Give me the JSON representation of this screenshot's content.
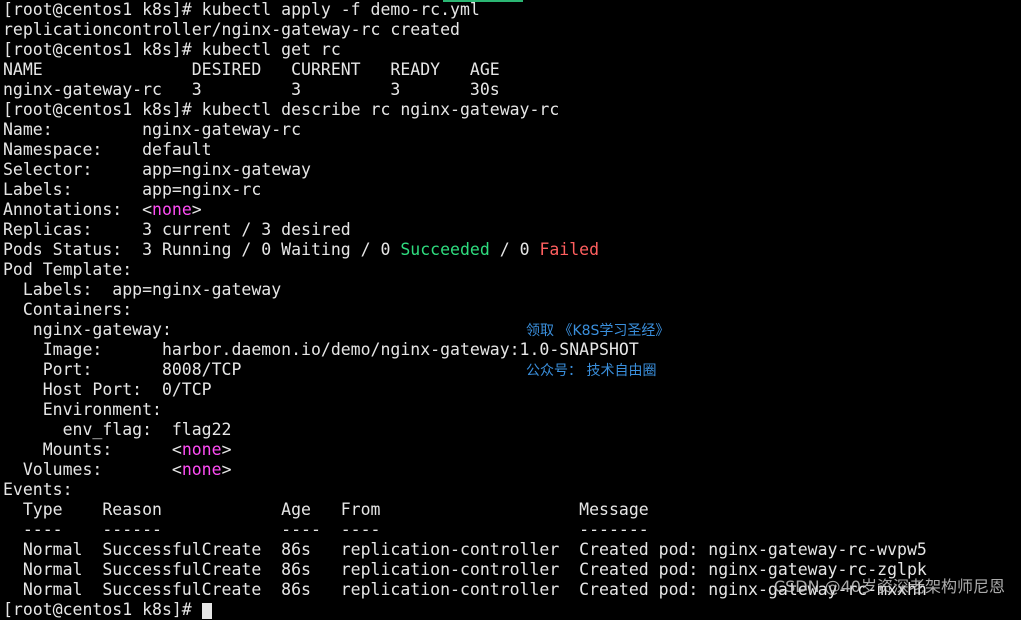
{
  "terminal": {
    "lines": [
      [
        {
          "t": "[root@centos1 k8s]# kubectl apply -f demo-rc.yml"
        }
      ],
      [
        {
          "t": "replicationcontroller/nginx-gateway-rc created"
        }
      ],
      [
        {
          "t": "[root@centos1 k8s]# kubectl get rc"
        }
      ],
      [
        {
          "t": "NAME               DESIRED   CURRENT   READY   AGE"
        }
      ],
      [
        {
          "t": "nginx-gateway-rc   3         3         3       30s"
        }
      ],
      [
        {
          "t": "[root@centos1 k8s]# kubectl describe rc nginx-gateway-rc"
        }
      ],
      [
        {
          "t": "Name:         nginx-gateway-rc"
        }
      ],
      [
        {
          "t": "Namespace:    default"
        }
      ],
      [
        {
          "t": "Selector:     app=nginx-gateway"
        }
      ],
      [
        {
          "t": "Labels:       app=nginx-rc"
        }
      ],
      [
        {
          "t": "Annotations:  <"
        },
        {
          "t": "none",
          "c": "magenta"
        },
        {
          "t": ">"
        }
      ],
      [
        {
          "t": "Replicas:     3 current / 3 desired"
        }
      ],
      [
        {
          "t": "Pods Status:  3 Running / 0 Waiting / 0 "
        },
        {
          "t": "Succeeded",
          "c": "green"
        },
        {
          "t": " / 0 "
        },
        {
          "t": "Failed",
          "c": "red"
        }
      ],
      [
        {
          "t": "Pod Template:"
        }
      ],
      [
        {
          "t": "  Labels:  app=nginx-gateway"
        }
      ],
      [
        {
          "t": "  Containers:"
        }
      ],
      [
        {
          "t": "   nginx-gateway:"
        }
      ],
      [
        {
          "t": "    Image:      harbor.daemon.io/demo/nginx-gateway:1.0-SNAPSHOT"
        }
      ],
      [
        {
          "t": "    Port:       8008/TCP"
        }
      ],
      [
        {
          "t": "    Host Port:  0/TCP"
        }
      ],
      [
        {
          "t": "    Environment:"
        }
      ],
      [
        {
          "t": "      env_flag:  flag22"
        }
      ],
      [
        {
          "t": "    Mounts:      <"
        },
        {
          "t": "none",
          "c": "magenta"
        },
        {
          "t": ">"
        }
      ],
      [
        {
          "t": "  Volumes:       <"
        },
        {
          "t": "none",
          "c": "magenta"
        },
        {
          "t": ">"
        }
      ],
      [
        {
          "t": "Events:"
        }
      ],
      [
        {
          "t": "  Type    Reason            Age   From                    Message"
        }
      ],
      [
        {
          "t": "  ----    ------            ----  ----                    -------"
        }
      ],
      [
        {
          "t": "  Normal  SuccessfulCreate  86s   replication-controller  Created pod: nginx-gateway-rc-wvpw5"
        }
      ],
      [
        {
          "t": "  Normal  SuccessfulCreate  86s   replication-controller  Created pod: nginx-gateway-rc-zglpk"
        }
      ],
      [
        {
          "t": "  Normal  SuccessfulCreate  86s   replication-controller  Created pod: nginx-gateway-rc-mxxhh"
        }
      ],
      [
        {
          "t": "[root@centos1 k8s]# "
        }
      ]
    ]
  },
  "watermark": {
    "line1": "领取 《K8S学习圣经》",
    "line2": "公众号： 技术自由圈"
  },
  "footer": {
    "csdn": "CSDN @40岁资深老架构师尼恩"
  },
  "colors": {
    "background": "#000000",
    "text": "#e6e6e6",
    "none_value": "#ff4df5",
    "succeeded": "#2fdc7f",
    "failed": "#ff5f5f",
    "watermark": "#3a8fdc"
  }
}
